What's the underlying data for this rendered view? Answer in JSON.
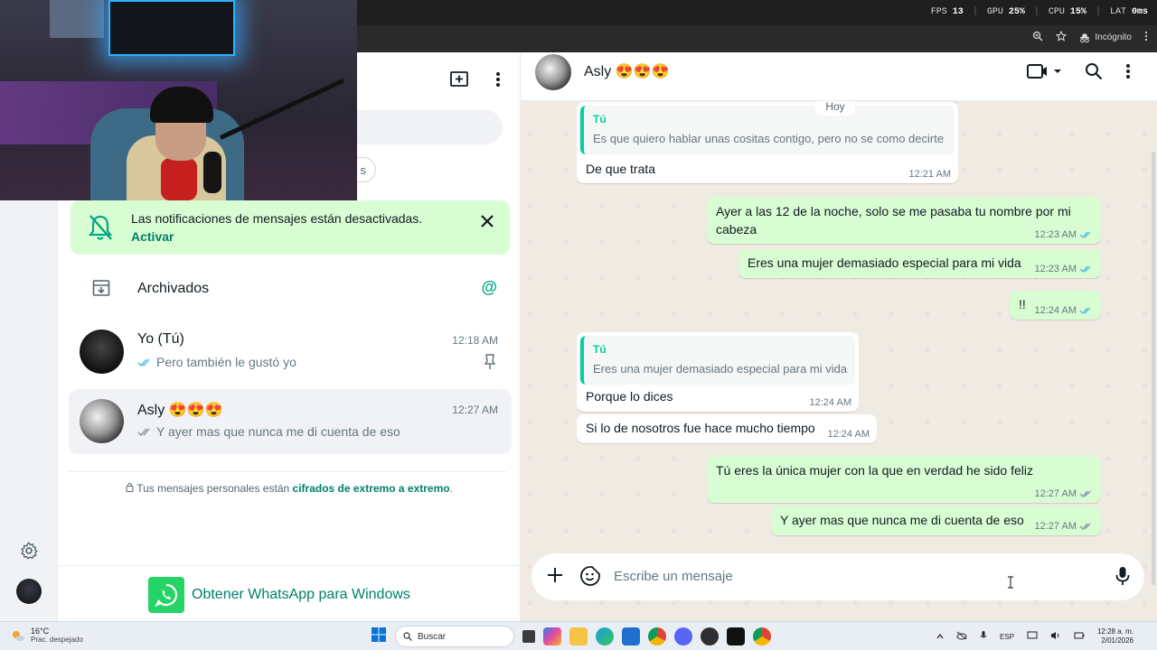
{
  "overlay": {
    "fps_label": "FPS",
    "fps": "13",
    "gpu_label": "GPU",
    "gpu": "25%",
    "cpu_label": "CPU",
    "cpu": "15%",
    "lat_label": "LAT",
    "lat": "0ms"
  },
  "browser": {
    "incognito_label": "Incógnito"
  },
  "list": {
    "notif_text": "Las notificaciones de mensajes están desactivadas.",
    "notif_action": "Activar",
    "archived_label": "Archivados",
    "chats": [
      {
        "name": "Yo (Tú)",
        "time": "12:18 AM",
        "preview": "Pero también le gustó yo"
      },
      {
        "name": "Asly 😍😍😍",
        "time": "12:27 AM",
        "preview": "Y ayer mas que nunca me di cuenta de eso"
      }
    ],
    "encrypt_prefix": "Tus mensajes personales están",
    "encrypt_link": "cifrados de extremo a extremo",
    "encrypt_suffix": ".",
    "get_app": "Obtener WhatsApp para Windows"
  },
  "conversation": {
    "contact_name": "Asly 😍😍😍",
    "day_chip": "Hoy",
    "messages": [
      {
        "dir": "in",
        "quote_author": "Tú",
        "quote_text": "Es que quiero hablar unas cositas contigo, pero no se como decirte",
        "text": "De que trata",
        "time": "12:21 AM"
      },
      {
        "dir": "out",
        "text_line1": "Ayer a las 12 de la noche, solo se me pasaba tu nombre por mi",
        "text_line2": "cabeza",
        "time": "12:23 AM"
      },
      {
        "dir": "out",
        "text": "Eres una mujer demasiado especial para mi vida",
        "time": "12:23 AM"
      },
      {
        "dir": "out",
        "text": "!!",
        "time": "12:24 AM"
      },
      {
        "dir": "in",
        "quote_author": "Tú",
        "quote_text": "Eres una mujer demasiado especial para mi vida",
        "text": "Porque lo dices",
        "time": "12:24 AM"
      },
      {
        "dir": "in",
        "text": "Si lo de nosotros fue hace mucho tiempo",
        "time": "12:24 AM"
      },
      {
        "dir": "out",
        "text": "Tú eres la única mujer con la que en verdad he sido feliz",
        "time": "12:27 AM"
      },
      {
        "dir": "out",
        "text": "Y ayer mas que nunca me di cuenta de eso",
        "time": "12:27 AM"
      }
    ],
    "composer_placeholder": "Escribe un mensaje"
  },
  "taskbar": {
    "temp": "16°C",
    "weather": "Prac. despejado",
    "search_label": "Buscar",
    "lang": "ESP",
    "time": "12:28 a. m.",
    "date": "2/01/2026"
  },
  "colors": {
    "accent": "#00a884",
    "outgoing": "#d9fdd3",
    "wallpaper": "#efeae2",
    "tick_blue": "#53bdeb"
  }
}
